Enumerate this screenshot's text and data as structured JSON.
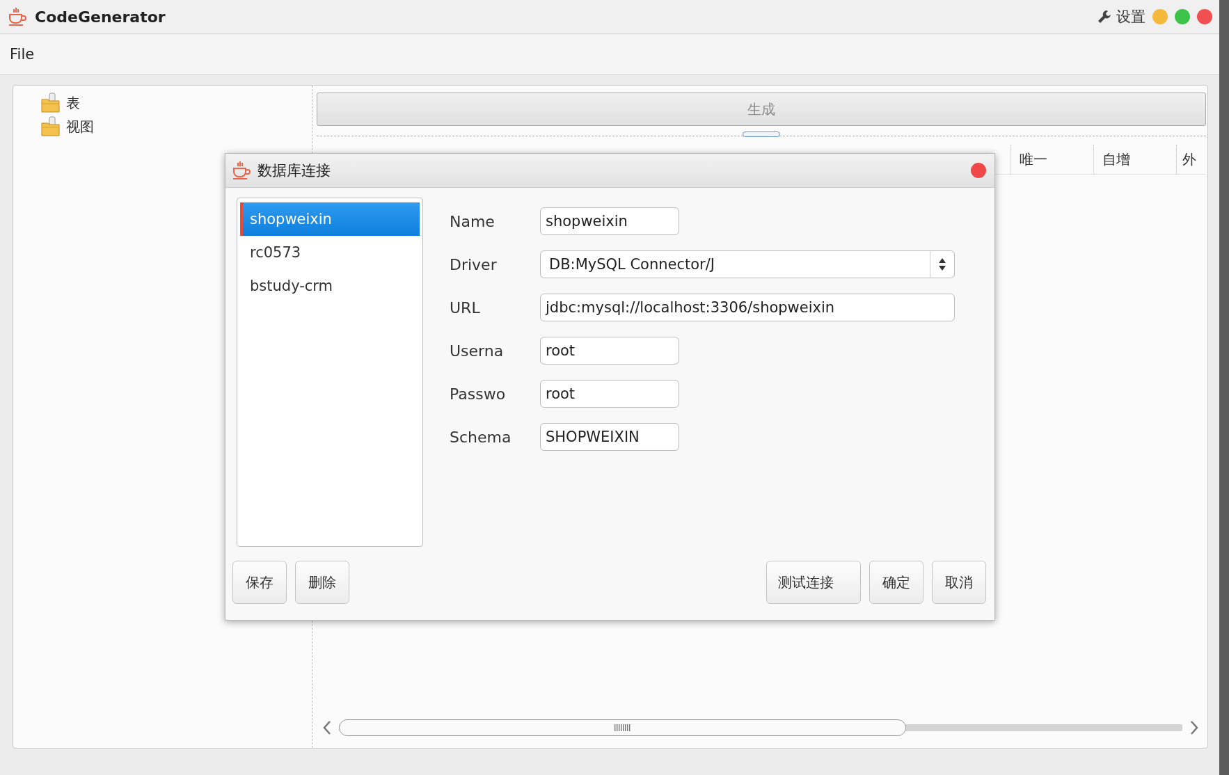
{
  "window": {
    "title": "CodeGenerator",
    "settings": "设置"
  },
  "menu": [
    "File"
  ],
  "tree": [
    {
      "label": "表"
    },
    {
      "label": "视图"
    }
  ],
  "generate_button": {
    "label": "生成",
    "disabled": true
  },
  "table": {
    "columns": [
      "唯一",
      "自增",
      "外"
    ]
  },
  "dialog": {
    "title": "数据库连接",
    "connections": [
      {
        "label": "shopweixin",
        "selected": true
      },
      {
        "label": "rc0573",
        "selected": false
      },
      {
        "label": "bstudy-crm",
        "selected": false
      }
    ],
    "fields": [
      {
        "label": "Name",
        "value": "shopweixin",
        "kind": "text"
      },
      {
        "label": "Driver",
        "value": "DB:MySQL Connector/J",
        "kind": "select"
      },
      {
        "label": "URL",
        "value": "jdbc:mysql://localhost:3306/shopweixin",
        "kind": "wide"
      },
      {
        "label": "Userna",
        "value": "root",
        "kind": "text"
      },
      {
        "label": "Passwo",
        "value": "root",
        "kind": "text"
      },
      {
        "label": "Schema",
        "value": "SHOPWEIXIN",
        "kind": "text"
      }
    ],
    "left_buttons": [
      "保存",
      "删除"
    ],
    "right_buttons": [
      "测试连接",
      "确定",
      "取消"
    ]
  }
}
